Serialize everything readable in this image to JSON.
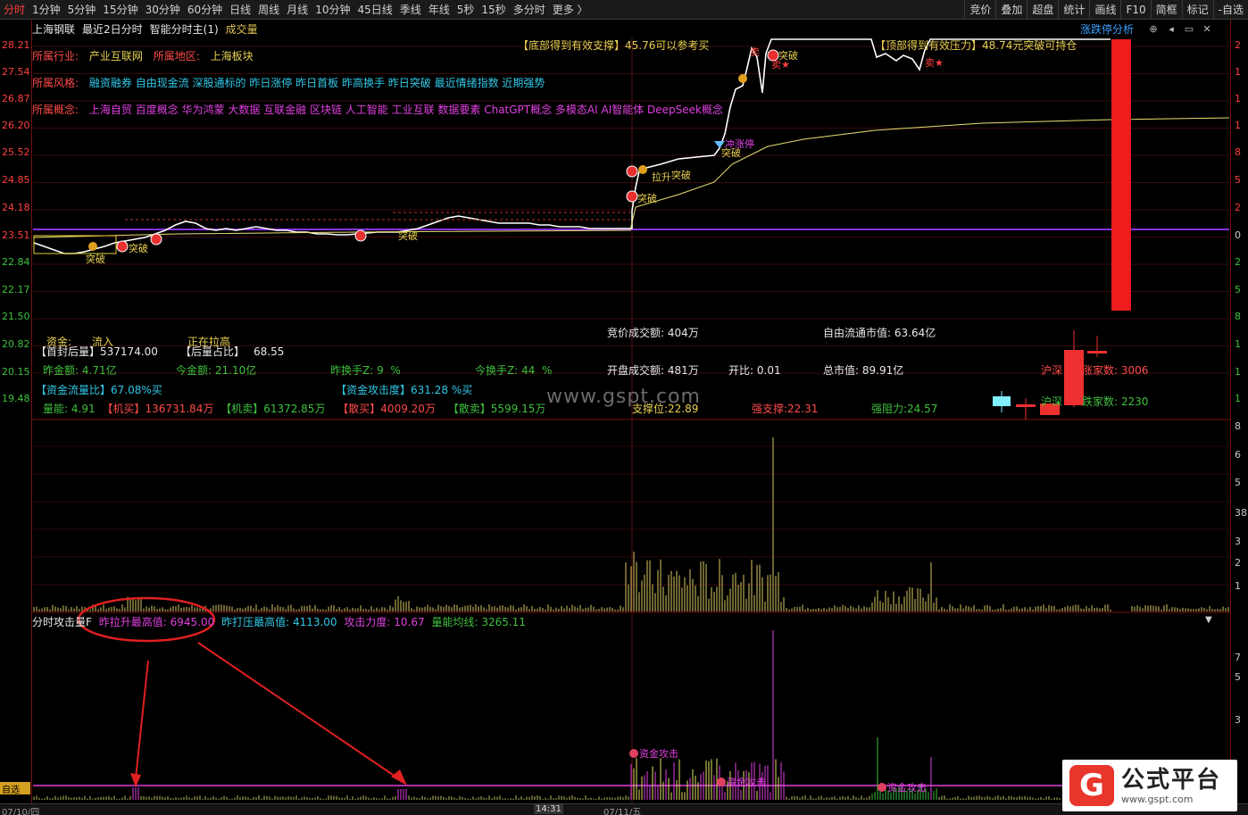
{
  "toolbar": {
    "tabs": [
      "分时",
      "1分钟",
      "5分钟",
      "15分钟",
      "30分钟",
      "60分钟",
      "日线",
      "周线",
      "月线",
      "10分钟",
      "45日线",
      "季线",
      "年线",
      "5秒",
      "15秒",
      "多分时",
      "更多 〉"
    ],
    "active_index": 0,
    "right_tabs": [
      "竞价",
      "叠加",
      "超盘",
      "统计",
      "画线",
      "F10",
      "简框",
      "标记",
      "-自选"
    ]
  },
  "header": {
    "stock_name": "上海钢联",
    "period": "最近2日分时",
    "mode": "智能分时主(1)",
    "volume_label": "成交量",
    "limit_analysis": "涨跌停分析",
    "icons": [
      "target-icon",
      "arrow-left-icon",
      "window-icon",
      "close-icon"
    ]
  },
  "left_axis": [
    "28.21",
    "27.54",
    "26.87",
    "26.20",
    "25.52",
    "24.85",
    "24.18",
    "23.51",
    "22.84",
    "22.17",
    "21.50",
    "20.82",
    "20.15",
    "19.48"
  ],
  "right_axis": [
    "2",
    "1",
    "1",
    "1",
    "8",
    "5",
    "2",
    "0",
    "2",
    "5",
    "8",
    "1",
    "1",
    "1",
    "8",
    "6",
    "5",
    "38",
    "3",
    "2",
    "1",
    "7",
    "5",
    "3"
  ],
  "info": {
    "industry_label": "所属行业:",
    "industry_value": "产业互联网",
    "region_label": "所属地区:",
    "region_value": "上海板块",
    "style_label": "所属风格:",
    "style_value": "融资融券 自由现金流 深股通标的 昨日涨停 昨日首板 昨高换手 昨日突破 最近情绪指数 近期强势",
    "concept_label": "所属概念:",
    "concept_value": "上海自贸 百度概念 华为鸿蒙 大数据 互联金融 区块链 人工智能 工业互联 数据要素 ChatGPT概念 多模态AI AI智能体 DeepSeek概念"
  },
  "annotations": {
    "support_top": "【底部得到有效支撑】45.76可以参考买",
    "pressure_top": "【顶部得到有效压力】48.74元突破可持仓",
    "breakouts": [
      "突破",
      "突破",
      "突破",
      "突破",
      "突破",
      "突破"
    ],
    "pull_up": "拉升",
    "limit_up": "冲涨停",
    "sell": "卖",
    "sell_star": "卖★",
    "attack": "资金攻击"
  },
  "stats": {
    "fund_label": "资金:",
    "fund_value": "流入",
    "fund_state": "正在拉高",
    "first_seal_label": "【首封后量】",
    "first_seal_value": "537174.00",
    "after_ratio_label": "【后量占比】",
    "after_ratio_value": "68.55",
    "yday_amount_label": "昨金额:",
    "yday_amount_value": "4.71亿",
    "today_amount_label": "今金额:",
    "today_amount_value": "21.10亿",
    "yday_turnover_label": "昨换手Z:",
    "yday_turnover_value": "9",
    "yday_turnover_unit": "%",
    "today_turnover_label": "今换手Z:",
    "today_turnover_value": "44",
    "today_turnover_unit": "%",
    "flow_ratio_label": "【资金流量比】",
    "flow_ratio_value": "67.08%买",
    "attack_label": "【资金攻击度】",
    "attack_value": "631.28 %买",
    "energy_label": "量能:",
    "energy_value": "4.91",
    "inst_buy_label": "【机买】",
    "inst_buy_value": "136731.84万",
    "inst_sell_label": "【机卖】",
    "inst_sell_value": "61372.85万",
    "retail_buy_label": "【散买】",
    "retail_buy_value": "4009.20万",
    "retail_sell_label": "【散卖】",
    "retail_sell_value": "5599.15万",
    "auction_label": "竞价成交额:",
    "auction_value": "404万",
    "open_label": "开盘成交额:",
    "open_value": "481万",
    "open_ratio_label": "开比:",
    "open_ratio_value": "0.01",
    "float_cap_label": "自由流通市值:",
    "float_cap_value": "63.64亿",
    "total_cap_label": "总市值:",
    "total_cap_value": "89.91亿",
    "support_label": "支撑位:",
    "support_value": "22.89",
    "strong_support_label": "强支撑:",
    "strong_support_value": "22.31",
    "strong_resist_label": "强阻力:",
    "strong_resist_value": "24.57",
    "hs_label": "沪深",
    "up_count_label": "涨家数:",
    "up_count_value": "3006",
    "hs2_label": "沪深",
    "down_count_label": "跌家数:",
    "down_count_value": "2230"
  },
  "sub_indicator": {
    "name": "分时攻击量F",
    "pull_max_label": "昨拉升最高值:",
    "pull_max_value": "6945.00",
    "press_max_label": "昨打压最高值:",
    "press_max_value": "4113.00",
    "force_label": "攻击力度:",
    "force_value": "10.67",
    "avg_label": "量能均线:",
    "avg_value": "3265.11"
  },
  "bottom": {
    "date1": "07/10/四",
    "time": "14:31",
    "date2": "07/11/五",
    "tag": "自选"
  },
  "watermark": "www.gspt.com",
  "logo": {
    "mark": "G",
    "title": "公式平台",
    "url": "www.gspt.com"
  },
  "colors": {
    "up": "#ff3b3b",
    "down": "#3ec03e",
    "price_line": "#ffffff",
    "avg_line": "#e8e070",
    "base_line": "#8a30e0"
  }
}
